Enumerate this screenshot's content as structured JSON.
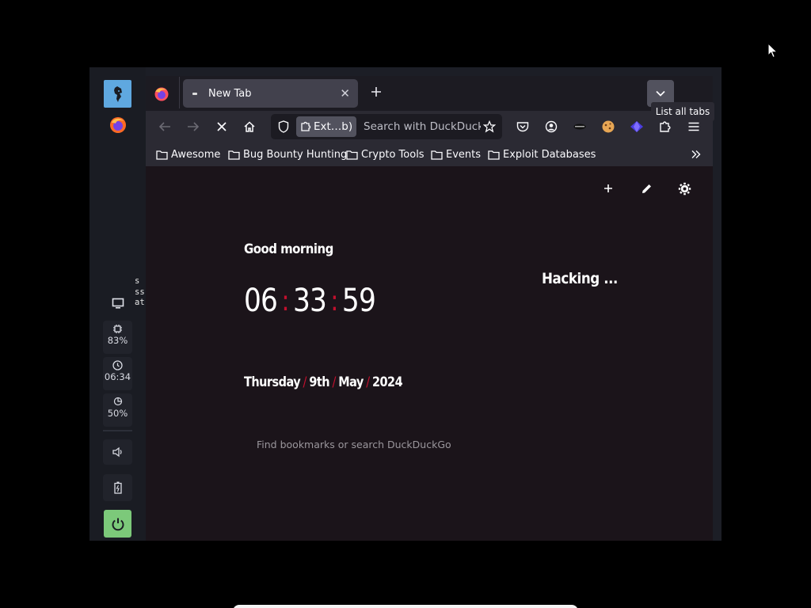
{
  "dock": {
    "icons": {
      "launcher": "cat-head-icon",
      "browser": "firefox-icon",
      "display": "monitor-icon",
      "volume": "speaker-icon",
      "battery": "battery-icon",
      "power": "power-icon"
    },
    "cpu": {
      "icon": "cpu-icon",
      "value": "83%"
    },
    "clock": {
      "icon": "clock-icon",
      "value": "06:34"
    },
    "memory": {
      "icon": "pie-icon",
      "value": "50%"
    },
    "terminal_fragment": "s\nss\nat",
    "colors": {
      "launcher": "#5fa8e0",
      "power": "#7cc97a"
    }
  },
  "browser": {
    "tab": {
      "title": "New Tab"
    },
    "tooltip": "List all tabs",
    "urlbar": {
      "extension_chip": "Ext…b)",
      "placeholder": "Search with DuckDuckGo"
    },
    "bookmarks": [
      {
        "label": "Awesome"
      },
      {
        "label": "Bug Bounty Hunting"
      },
      {
        "label": "Crypto Tools"
      },
      {
        "label": "Events"
      },
      {
        "label": "Exploit Databases"
      }
    ]
  },
  "newtab": {
    "greeting": "Good morning",
    "tagline": "Hacking ...",
    "clock": {
      "hours": "06",
      "minutes": "33",
      "seconds": "59",
      "separator": ":"
    },
    "date": {
      "weekday": "Thursday",
      "day": "9th",
      "month": "May",
      "year": "2024",
      "separator": "/"
    },
    "search_hint": "Find bookmarks or search DuckDuckGo",
    "accent_color": "#c3102e"
  }
}
